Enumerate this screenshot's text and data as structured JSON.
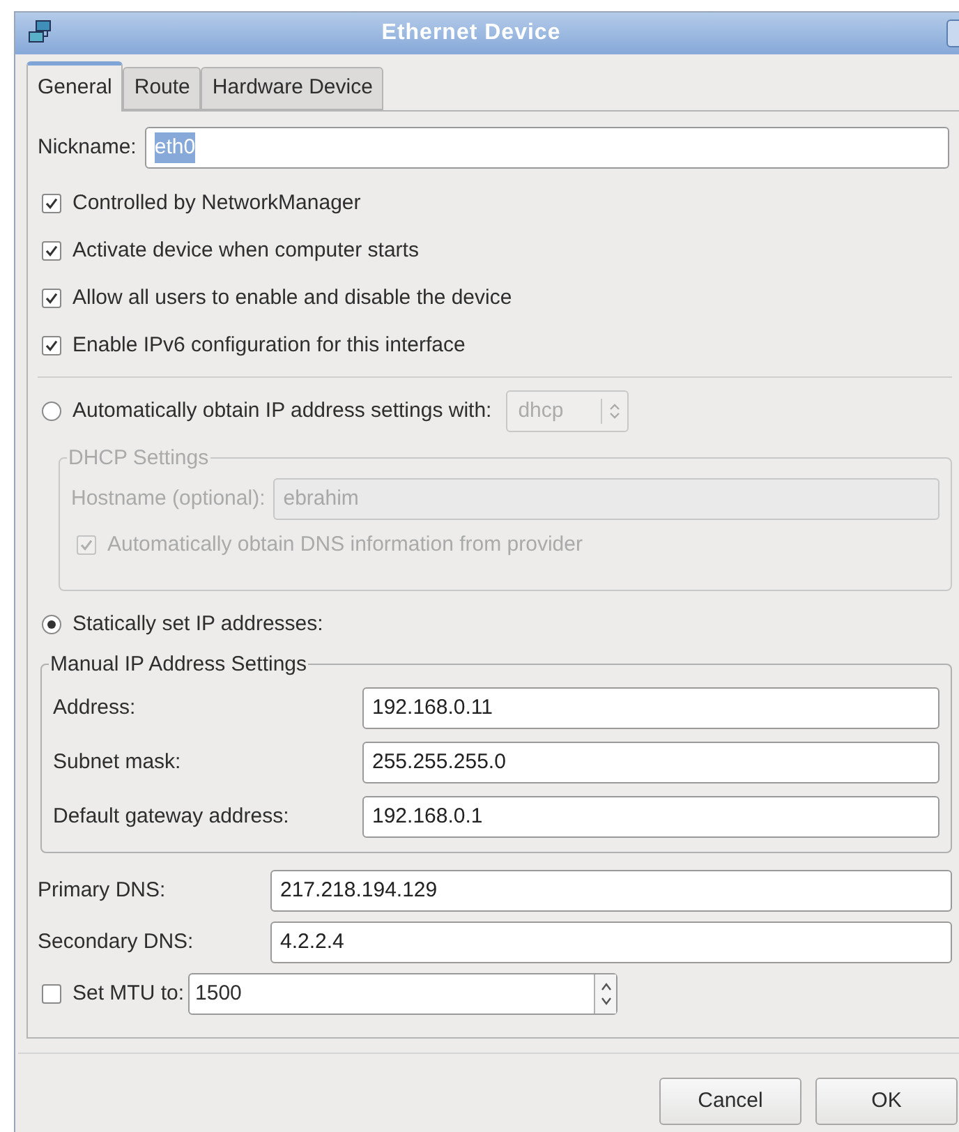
{
  "window": {
    "title": "Ethernet Device"
  },
  "tabs": [
    {
      "label": "General",
      "selected": true
    },
    {
      "label": "Route",
      "selected": false
    },
    {
      "label": "Hardware Device",
      "selected": false
    }
  ],
  "nickname": {
    "label": "Nickname:",
    "value": "eth0",
    "text_selected": true
  },
  "options": [
    {
      "label": "Controlled by NetworkManager",
      "checked": true
    },
    {
      "label": "Activate device when computer starts",
      "checked": true
    },
    {
      "label": "Allow all users to enable and disable the device",
      "checked": true
    },
    {
      "label": "Enable IPv6 configuration for this interface",
      "checked": true
    }
  ],
  "auto_ip": {
    "label": "Automatically obtain IP address settings with:",
    "selected": false,
    "method": "dhcp"
  },
  "dhcp_settings": {
    "title": "DHCP Settings",
    "disabled": true,
    "hostname": {
      "label": "Hostname (optional):",
      "value": "ebrahim"
    },
    "auto_dns": {
      "label": "Automatically obtain DNS information from provider",
      "checked": true
    }
  },
  "static_ip": {
    "label": "Statically set IP addresses:",
    "selected": true
  },
  "manual_settings": {
    "title": "Manual IP Address Settings",
    "fields": [
      {
        "label": "Address:",
        "value": "192.168.0.11"
      },
      {
        "label": "Subnet mask:",
        "value": "255.255.255.0"
      },
      {
        "label": "Default gateway address:",
        "value": "192.168.0.1"
      }
    ]
  },
  "dns": [
    {
      "label": "Primary DNS:",
      "value": "217.218.194.129"
    },
    {
      "label": "Secondary DNS:",
      "value": "4.2.2.4"
    }
  ],
  "mtu": {
    "label": "Set MTU to:",
    "checked": false,
    "value": "1500"
  },
  "buttons": [
    {
      "label": "Cancel"
    },
    {
      "label": "OK"
    }
  ]
}
